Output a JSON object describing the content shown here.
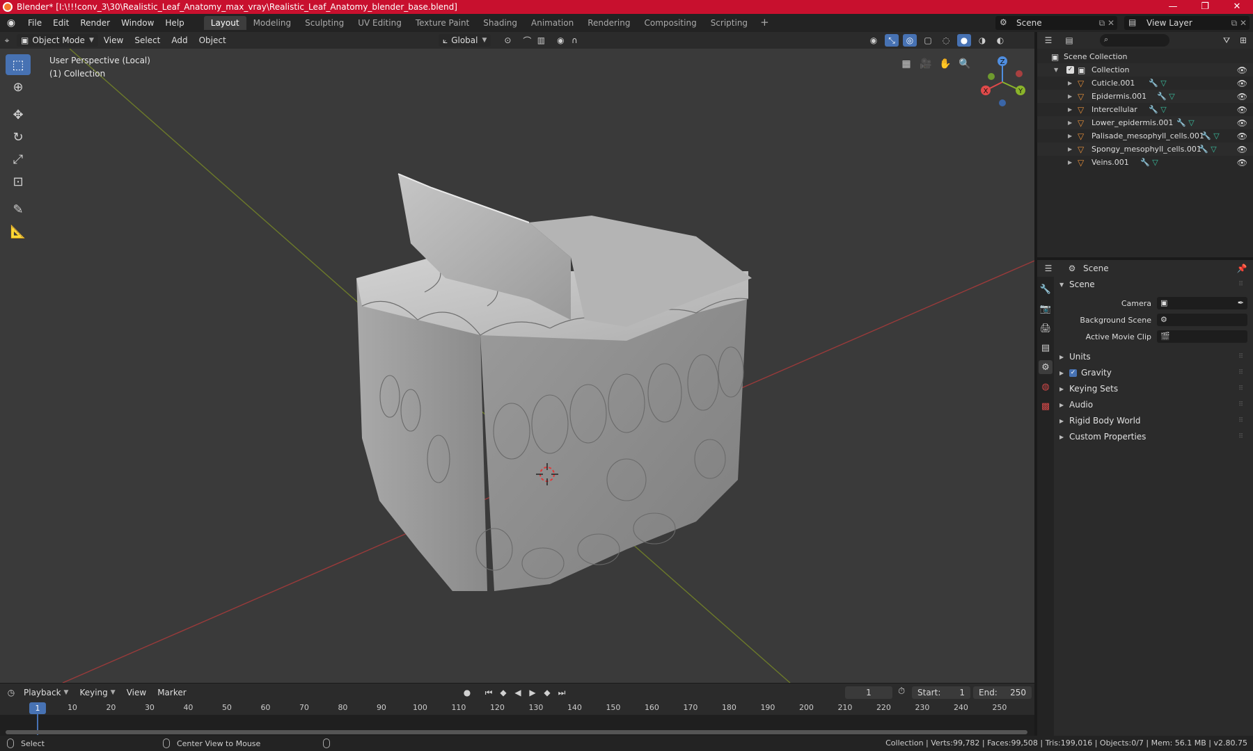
{
  "window": {
    "title": "Blender* [I:\\!!!conv_3\\30\\Realistic_Leaf_Anatomy_max_vray\\Realistic_Leaf_Anatomy_blender_base.blend]",
    "minimize": "—",
    "maximize": "❐",
    "close": "✕"
  },
  "menubar": {
    "items": [
      "File",
      "Edit",
      "Render",
      "Window",
      "Help"
    ]
  },
  "workspaces": {
    "tabs": [
      "Layout",
      "Modeling",
      "Sculpting",
      "UV Editing",
      "Texture Paint",
      "Shading",
      "Animation",
      "Rendering",
      "Compositing",
      "Scripting"
    ],
    "active": "Layout",
    "add": "+"
  },
  "scene_selector": {
    "value": "Scene"
  },
  "view_layer_selector": {
    "value": "View Layer"
  },
  "viewport_header": {
    "mode": "Object Mode",
    "menus": [
      "View",
      "Select",
      "Add",
      "Object"
    ],
    "transform_orientation": "Global"
  },
  "viewport": {
    "perspective_label": "User Perspective (Local)",
    "collection_label": "(1) Collection",
    "axis_labels": {
      "x": "X",
      "y": "Y",
      "z": "Z"
    }
  },
  "outliner": {
    "search_placeholder": "",
    "root": "Scene Collection",
    "collection": "Collection",
    "objects": [
      "Cuticle.001",
      "Epidermis.001",
      "Intercellular",
      "Lower_epidermis.001",
      "Palisade_mesophyll_cells.001",
      "Spongy_mesophyll_cells.001",
      "Veins.001"
    ]
  },
  "properties": {
    "context": "Scene",
    "panel_scene": "Scene",
    "camera_label": "Camera",
    "background_scene_label": "Background Scene",
    "active_movie_clip_label": "Active Movie Clip",
    "panels": [
      "Units",
      "Gravity",
      "Keying Sets",
      "Audio",
      "Rigid Body World",
      "Custom Properties"
    ],
    "gravity_checked": true
  },
  "timeline": {
    "menus": [
      "Playback",
      "Keying",
      "View",
      "Marker"
    ],
    "current_frame": "1",
    "start_label": "Start:",
    "start_value": "1",
    "end_label": "End:",
    "end_value": "250",
    "ticks": [
      "10",
      "20",
      "30",
      "40",
      "50",
      "60",
      "70",
      "80",
      "90",
      "100",
      "110",
      "120",
      "130",
      "140",
      "150",
      "160",
      "170",
      "180",
      "190",
      "200",
      "210",
      "220",
      "230",
      "240",
      "250"
    ],
    "cursor_label": "1"
  },
  "statusbar": {
    "select": "Select",
    "center_view": "Center View to Mouse",
    "stats": "Collection | Verts:99,782 | Faces:99,508 | Tris:199,016 | Objects:0/7 | Mem: 56.1 MB | v2.80.75"
  }
}
